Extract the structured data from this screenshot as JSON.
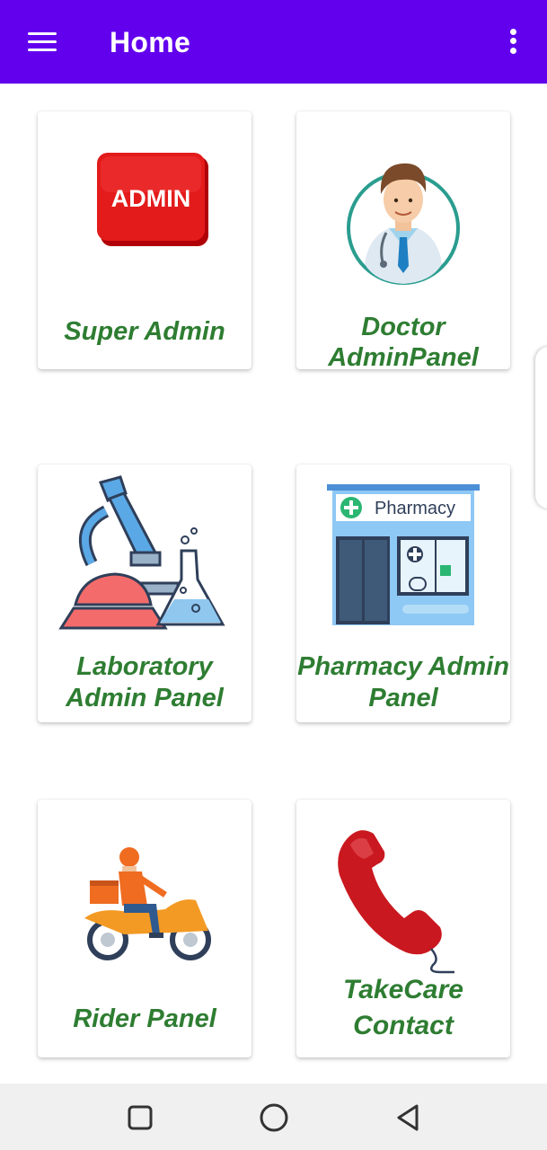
{
  "appbar": {
    "title": "Home",
    "menu_icon": "hamburger-menu-icon",
    "overflow_icon": "more-vert-icon",
    "color": "#6200ee"
  },
  "cards": [
    {
      "label": "Super Admin",
      "icon": "admin-badge-icon"
    },
    {
      "label": "Doctor\nAdminPanel",
      "icon": "doctor-icon"
    },
    {
      "label": "Laboratory\nAdmin Panel",
      "icon": "microscope-icon"
    },
    {
      "label": "Pharmacy Admin\nPanel",
      "icon": "pharmacy-store-icon"
    },
    {
      "label": "Rider Panel",
      "icon": "delivery-rider-icon"
    },
    {
      "label": "TakeCare\nContact",
      "icon": "telephone-handset-icon"
    }
  ],
  "admin_badge_text": "ADMIN",
  "pharmacy_sign_text": "Pharmacy",
  "label_color": "#2e7d32",
  "navbar": {
    "recents_icon": "recents-square-icon",
    "home_icon": "home-circle-icon",
    "back_icon": "back-triangle-icon"
  }
}
